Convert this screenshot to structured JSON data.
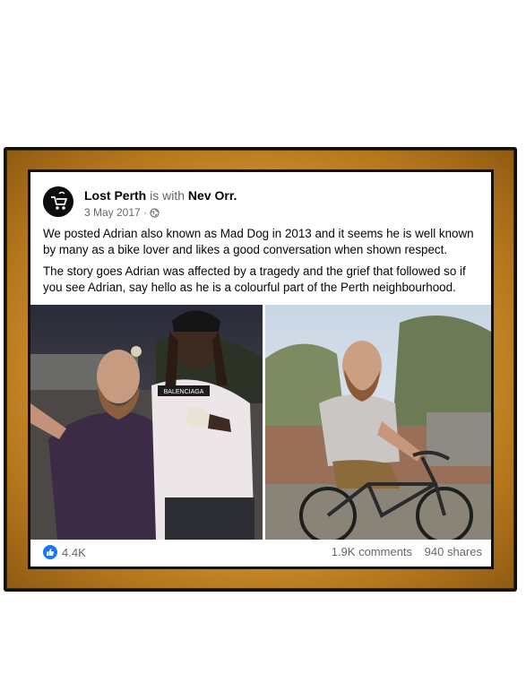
{
  "post": {
    "author": "Lost Perth",
    "with_text": "is with",
    "tagged": "Nev Orr.",
    "date": "3 May 2017 ·",
    "audience_icon": "globe-icon",
    "paragraphs": [
      "We posted Adrian also known as Mad Dog in 2013 and it seems he is well known by many as a bike lover and likes a good conversation when shown respect.",
      "The story goes Adrian was affected by a tragedy and the grief that followed so if you see Adrian, say hello as he is a colourful part of the Perth neighbourhood."
    ],
    "photo_left_shirt_text": "BALENCIAGA",
    "reactions": "4.4K",
    "comments": "1.9K comments",
    "shares": "940 shares"
  },
  "colors": {
    "frame": "#c68a2a",
    "like_blue": "#1877f2",
    "meta_gray": "#65676b"
  }
}
